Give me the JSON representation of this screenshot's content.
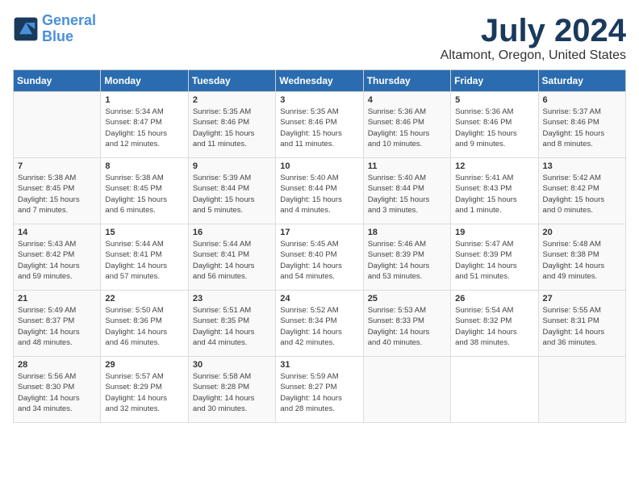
{
  "logo": {
    "line1": "General",
    "line2": "Blue"
  },
  "title": "July 2024",
  "location": "Altamont, Oregon, United States",
  "days_of_week": [
    "Sunday",
    "Monday",
    "Tuesday",
    "Wednesday",
    "Thursday",
    "Friday",
    "Saturday"
  ],
  "weeks": [
    [
      {
        "day": "",
        "info": ""
      },
      {
        "day": "1",
        "info": "Sunrise: 5:34 AM\nSunset: 8:47 PM\nDaylight: 15 hours\nand 12 minutes."
      },
      {
        "day": "2",
        "info": "Sunrise: 5:35 AM\nSunset: 8:46 PM\nDaylight: 15 hours\nand 11 minutes."
      },
      {
        "day": "3",
        "info": "Sunrise: 5:35 AM\nSunset: 8:46 PM\nDaylight: 15 hours\nand 11 minutes."
      },
      {
        "day": "4",
        "info": "Sunrise: 5:36 AM\nSunset: 8:46 PM\nDaylight: 15 hours\nand 10 minutes."
      },
      {
        "day": "5",
        "info": "Sunrise: 5:36 AM\nSunset: 8:46 PM\nDaylight: 15 hours\nand 9 minutes."
      },
      {
        "day": "6",
        "info": "Sunrise: 5:37 AM\nSunset: 8:46 PM\nDaylight: 15 hours\nand 8 minutes."
      }
    ],
    [
      {
        "day": "7",
        "info": "Sunrise: 5:38 AM\nSunset: 8:45 PM\nDaylight: 15 hours\nand 7 minutes."
      },
      {
        "day": "8",
        "info": "Sunrise: 5:38 AM\nSunset: 8:45 PM\nDaylight: 15 hours\nand 6 minutes."
      },
      {
        "day": "9",
        "info": "Sunrise: 5:39 AM\nSunset: 8:44 PM\nDaylight: 15 hours\nand 5 minutes."
      },
      {
        "day": "10",
        "info": "Sunrise: 5:40 AM\nSunset: 8:44 PM\nDaylight: 15 hours\nand 4 minutes."
      },
      {
        "day": "11",
        "info": "Sunrise: 5:40 AM\nSunset: 8:44 PM\nDaylight: 15 hours\nand 3 minutes."
      },
      {
        "day": "12",
        "info": "Sunrise: 5:41 AM\nSunset: 8:43 PM\nDaylight: 15 hours\nand 1 minute."
      },
      {
        "day": "13",
        "info": "Sunrise: 5:42 AM\nSunset: 8:42 PM\nDaylight: 15 hours\nand 0 minutes."
      }
    ],
    [
      {
        "day": "14",
        "info": "Sunrise: 5:43 AM\nSunset: 8:42 PM\nDaylight: 14 hours\nand 59 minutes."
      },
      {
        "day": "15",
        "info": "Sunrise: 5:44 AM\nSunset: 8:41 PM\nDaylight: 14 hours\nand 57 minutes."
      },
      {
        "day": "16",
        "info": "Sunrise: 5:44 AM\nSunset: 8:41 PM\nDaylight: 14 hours\nand 56 minutes."
      },
      {
        "day": "17",
        "info": "Sunrise: 5:45 AM\nSunset: 8:40 PM\nDaylight: 14 hours\nand 54 minutes."
      },
      {
        "day": "18",
        "info": "Sunrise: 5:46 AM\nSunset: 8:39 PM\nDaylight: 14 hours\nand 53 minutes."
      },
      {
        "day": "19",
        "info": "Sunrise: 5:47 AM\nSunset: 8:39 PM\nDaylight: 14 hours\nand 51 minutes."
      },
      {
        "day": "20",
        "info": "Sunrise: 5:48 AM\nSunset: 8:38 PM\nDaylight: 14 hours\nand 49 minutes."
      }
    ],
    [
      {
        "day": "21",
        "info": "Sunrise: 5:49 AM\nSunset: 8:37 PM\nDaylight: 14 hours\nand 48 minutes."
      },
      {
        "day": "22",
        "info": "Sunrise: 5:50 AM\nSunset: 8:36 PM\nDaylight: 14 hours\nand 46 minutes."
      },
      {
        "day": "23",
        "info": "Sunrise: 5:51 AM\nSunset: 8:35 PM\nDaylight: 14 hours\nand 44 minutes."
      },
      {
        "day": "24",
        "info": "Sunrise: 5:52 AM\nSunset: 8:34 PM\nDaylight: 14 hours\nand 42 minutes."
      },
      {
        "day": "25",
        "info": "Sunrise: 5:53 AM\nSunset: 8:33 PM\nDaylight: 14 hours\nand 40 minutes."
      },
      {
        "day": "26",
        "info": "Sunrise: 5:54 AM\nSunset: 8:32 PM\nDaylight: 14 hours\nand 38 minutes."
      },
      {
        "day": "27",
        "info": "Sunrise: 5:55 AM\nSunset: 8:31 PM\nDaylight: 14 hours\nand 36 minutes."
      }
    ],
    [
      {
        "day": "28",
        "info": "Sunrise: 5:56 AM\nSunset: 8:30 PM\nDaylight: 14 hours\nand 34 minutes."
      },
      {
        "day": "29",
        "info": "Sunrise: 5:57 AM\nSunset: 8:29 PM\nDaylight: 14 hours\nand 32 minutes."
      },
      {
        "day": "30",
        "info": "Sunrise: 5:58 AM\nSunset: 8:28 PM\nDaylight: 14 hours\nand 30 minutes."
      },
      {
        "day": "31",
        "info": "Sunrise: 5:59 AM\nSunset: 8:27 PM\nDaylight: 14 hours\nand 28 minutes."
      },
      {
        "day": "",
        "info": ""
      },
      {
        "day": "",
        "info": ""
      },
      {
        "day": "",
        "info": ""
      }
    ]
  ]
}
